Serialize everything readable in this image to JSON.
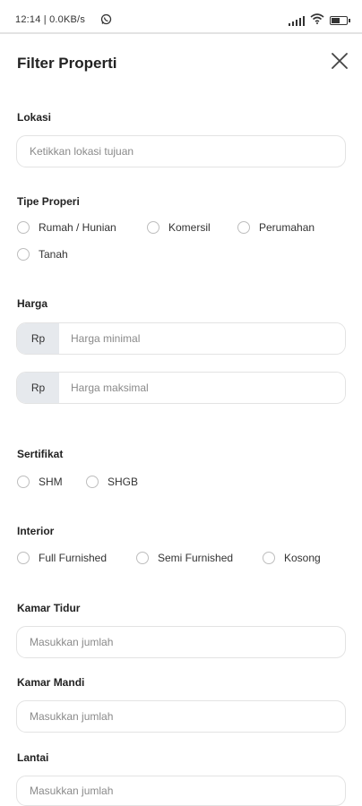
{
  "status_bar": {
    "time": "12:14 | 0.0KB/s",
    "battery_level": 0.6
  },
  "header": {
    "title": "Filter Properti",
    "close_icon": "close-icon"
  },
  "lokasi": {
    "label": "Lokasi",
    "placeholder": "Ketikkan lokasi tujuan"
  },
  "tipe_properti": {
    "label": "Tipe Properi",
    "options": [
      "Rumah / Hunian",
      "Komersil",
      "Perumahan",
      "Tanah"
    ]
  },
  "harga": {
    "label": "Harga",
    "prefix": "Rp",
    "min_placeholder": "Harga minimal",
    "max_placeholder": "Harga maksimal"
  },
  "sertifikat": {
    "label": "Sertifikat",
    "options": [
      "SHM",
      "SHGB"
    ]
  },
  "interior": {
    "label": "Interior",
    "options": [
      "Full Furnished",
      "Semi Furnished",
      "Kosong"
    ]
  },
  "kamar_tidur": {
    "label": "Kamar Tidur",
    "placeholder": "Masukkan jumlah"
  },
  "kamar_mandi": {
    "label": "Kamar Mandi",
    "placeholder": "Masukkan jumlah"
  },
  "lantai": {
    "label": "Lantai",
    "placeholder": "Masukkan jumlah"
  }
}
